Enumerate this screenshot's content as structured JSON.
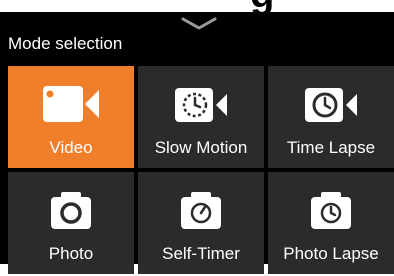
{
  "header": {
    "title": "Mode selection",
    "top_fragment": "g"
  },
  "colors": {
    "accent": "#f07f2c",
    "tile": "#2b2b2b",
    "background": "#000000",
    "text": "#ffffff"
  },
  "modes": [
    {
      "label": "Video",
      "icon": "video-camera-icon",
      "selected": true
    },
    {
      "label": "Slow Motion",
      "icon": "slow-motion-icon",
      "selected": false
    },
    {
      "label": "Time Lapse",
      "icon": "time-lapse-icon",
      "selected": false
    },
    {
      "label": "Photo",
      "icon": "photo-camera-icon",
      "selected": false
    },
    {
      "label": "Self-Timer",
      "icon": "self-timer-icon",
      "selected": false
    },
    {
      "label": "Photo Lapse",
      "icon": "photo-lapse-icon",
      "selected": false
    }
  ]
}
